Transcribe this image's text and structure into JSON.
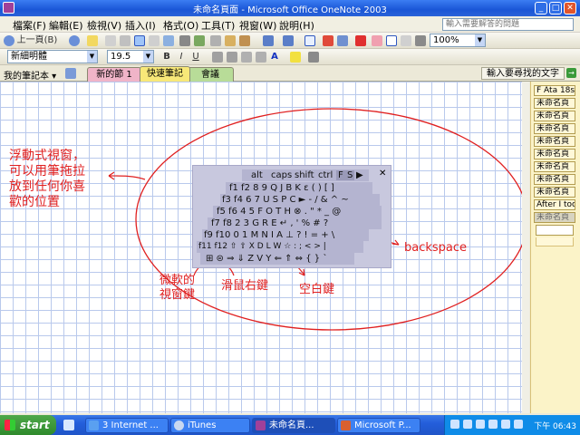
{
  "window": {
    "title": "未命名頁面 - Microsoft Office OneNote 2003"
  },
  "menu": {
    "items": [
      "檔案(F)",
      "編輯(E)",
      "檢視(V)",
      "插入(I)",
      "格式(O)",
      "工具(T)",
      "視窗(W)",
      "說明(H)"
    ],
    "help_placeholder": "輸入需要解答的問題"
  },
  "toolbar": {
    "back_label": "上一頁(B)",
    "zoom": "100%",
    "font": "新細明體",
    "size": "19.5"
  },
  "tabs": {
    "notebook_label": "我的筆記本 ▾",
    "sections": [
      {
        "label": "新的節 1",
        "color": "#f0b4c8"
      },
      {
        "label": "快速筆記",
        "color": "#f8e878"
      },
      {
        "label": "會議",
        "color": "#b8dc98"
      }
    ],
    "search_label": "輸入要尋找的文字"
  },
  "pages": [
    "F Ata 18st'",
    "未命名頁",
    "未命名頁",
    "未命名頁",
    "未命名頁",
    "未命名頁",
    "未命名頁",
    "未命名頁",
    "未命名頁",
    "After I too",
    "未命名頁"
  ],
  "keyboard": {
    "row0": [
      "alt",
      "caps",
      "shift",
      "ctrl",
      "F",
      "S",
      "▶"
    ],
    "close": "✕",
    "row1": "f1 f2 8 9 Q J B K ε ( ) [ ]",
    "row2": "f3 f4 6 7 U S P C ► - / & ^ ~",
    "row3": "f5 f6 4 5 F O T H ⊗ . \" * _ @",
    "row4": "f7 f8 2 3 G R E ↵ , ' % # ?",
    "row5": "f9 f10 0 1 M N I A ⊥ ? ! = + \\",
    "row6": "f11 f12 ⇧ ⇧ X D L W ☆ : ; < > |",
    "row7": "⊞ ⊜ ⇒ ⇓ Z V Y ⇐ ⇑ ⇔ { } `"
  },
  "annotations": {
    "floating": [
      "浮動式視窗，",
      "可以用筆拖拉",
      "放到任何你喜",
      "歡的位置"
    ],
    "backspace": "backspace",
    "winkey": [
      "微軟的",
      "視窗鍵"
    ],
    "rightclick": "滑鼠右鍵",
    "space": "空白鍵"
  },
  "taskbar": {
    "start": "start",
    "tasks": [
      "3 Internet ...",
      "iTunes",
      "未命名頁...",
      "Microsoft P..."
    ],
    "clock": "下午 06:43"
  }
}
